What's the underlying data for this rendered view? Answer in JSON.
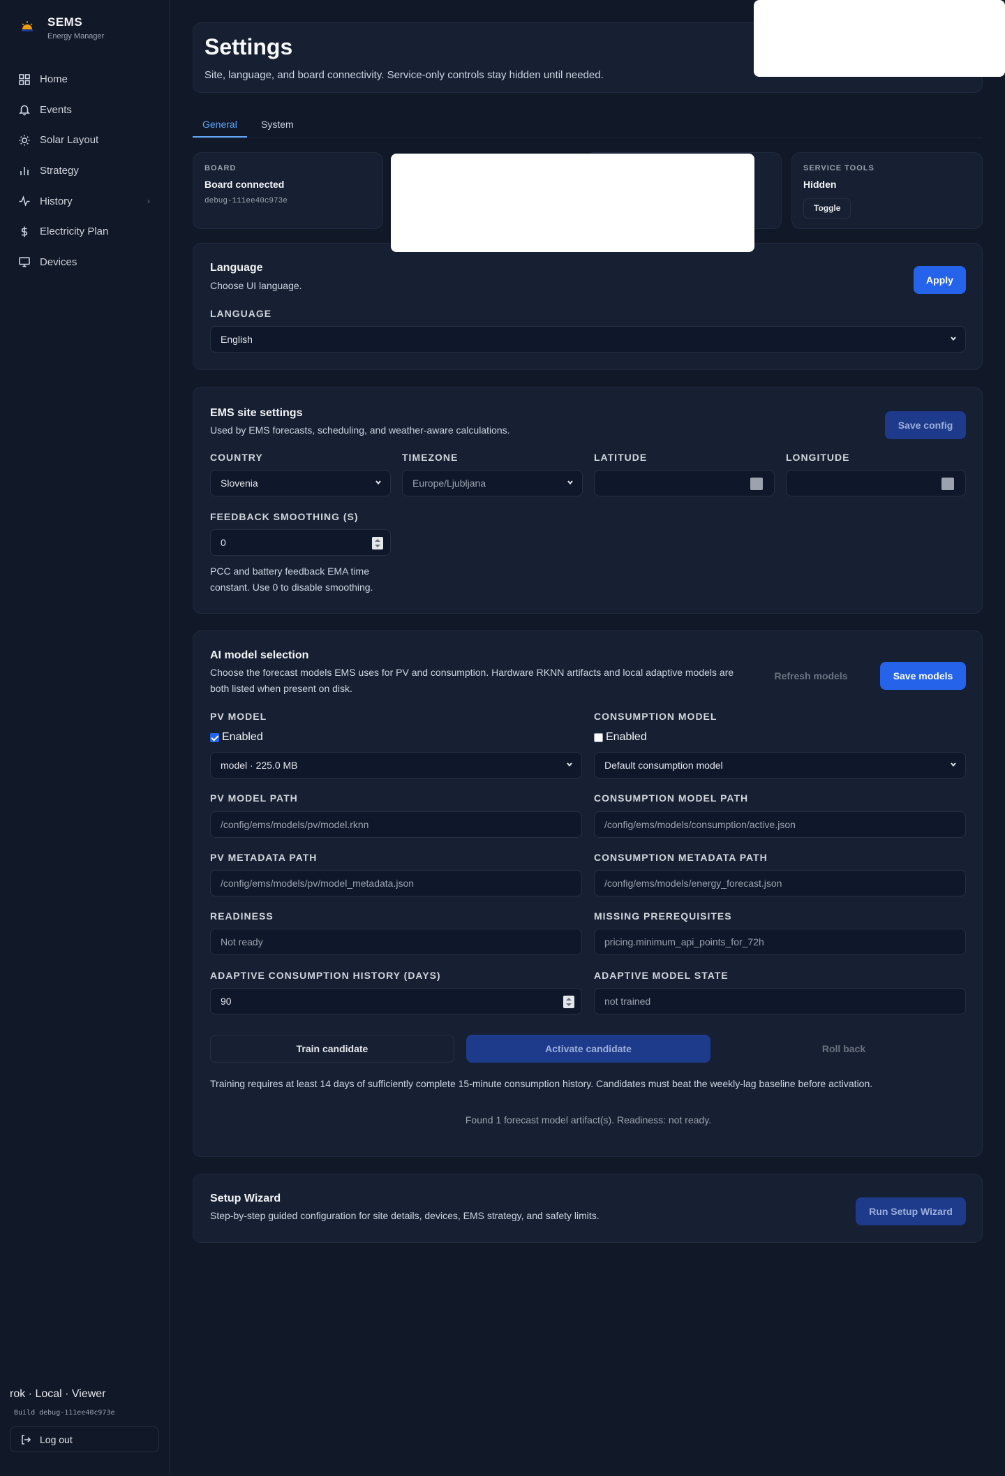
{
  "brand": {
    "title": "SEMS",
    "subtitle": "Energy Manager"
  },
  "nav": {
    "items": [
      {
        "label": "Home",
        "icon": "grid-icon"
      },
      {
        "label": "Events",
        "icon": "bell-icon"
      },
      {
        "label": "Solar Layout",
        "icon": "sun-icon"
      },
      {
        "label": "Strategy",
        "icon": "bar-chart-icon"
      },
      {
        "label": "History",
        "icon": "activity-icon"
      },
      {
        "label": "Electricity Plan",
        "icon": "dollar-icon"
      },
      {
        "label": "Devices",
        "icon": "monitor-icon"
      }
    ]
  },
  "footer": {
    "user": "rok · Local · Viewer",
    "build": "Build debug-111ee40c973e",
    "logout": "Log out"
  },
  "header": {
    "title": "Settings",
    "subtitle": "Site, language, and board connectivity. Service-only controls stay hidden until needed."
  },
  "tabs": [
    "General",
    "System"
  ],
  "board": {
    "label": "BOARD",
    "value": "Board connected",
    "meta": "debug-111ee40c973e"
  },
  "service_tools": {
    "label": "SERVICE TOOLS",
    "value": "Hidden",
    "button": "Toggle"
  },
  "language": {
    "title": "Language",
    "description": "Choose UI language.",
    "apply": "Apply",
    "field_label": "LANGUAGE",
    "value": "English"
  },
  "ems": {
    "title": "EMS site settings",
    "description": "Used by EMS forecasts, scheduling, and weather-aware calculations.",
    "save": "Save config",
    "country_label": "COUNTRY",
    "country": "Slovenia",
    "timezone_label": "TIMEZONE",
    "timezone": "Europe/Ljubljana",
    "latitude_label": "LATITUDE",
    "longitude_label": "LONGITUDE",
    "smoothing_label": "FEEDBACK SMOOTHING (S)",
    "smoothing": "0",
    "smoothing_help_1": "PCC and battery feedback EMA time",
    "smoothing_help_2": "constant. Use 0 to disable smoothing."
  },
  "ai": {
    "title": "AI model selection",
    "description_1": "Choose the forecast models EMS uses for PV and consumption. Hardware RKNN artifacts and local adaptive models are",
    "description_2": "both listed when present on disk.",
    "refresh": "Refresh models",
    "save": "Save models",
    "pv_model_label": "PV MODEL",
    "pv_enabled": "Enabled",
    "pv_model": "model · 225.0 MB",
    "consumption_model_label": "CONSUMPTION MODEL",
    "consumption_enabled": "Enabled",
    "consumption_model": "Default consumption model",
    "pv_path_label": "PV MODEL PATH",
    "pv_path": "/config/ems/models/pv/model.rknn",
    "consumption_path_label": "CONSUMPTION MODEL PATH",
    "consumption_path": "/config/ems/models/consumption/active.json",
    "pv_meta_label": "PV METADATA PATH",
    "pv_meta": "/config/ems/models/pv/model_metadata.json",
    "consumption_meta_label": "CONSUMPTION METADATA PATH",
    "consumption_meta": "/config/ems/models/energy_forecast.json",
    "readiness_label": "READINESS",
    "readiness": "Not ready",
    "missing_label": "MISSING PREREQUISITES",
    "missing": "pricing.minimum_api_points_for_72h",
    "history_label": "ADAPTIVE CONSUMPTION HISTORY (DAYS)",
    "history": "90",
    "state_label": "ADAPTIVE MODEL STATE",
    "state": "not trained",
    "train": "Train candidate",
    "activate": "Activate candidate",
    "rollback": "Roll back",
    "training_note": "Training requires at least 14 days of sufficiently complete 15-minute consumption history. Candidates must beat the weekly-lag baseline before activation.",
    "status": "Found 1 forecast model artifact(s). Readiness: not ready."
  },
  "wizard": {
    "title": "Setup Wizard",
    "description": "Step-by-step guided configuration for site details, devices, EMS strategy, and safety limits.",
    "button": "Run Setup Wizard"
  },
  "colors": {
    "accent": "#2563eb",
    "background": "#111827",
    "card": "#172032",
    "tab_active": "#60a5fa"
  }
}
